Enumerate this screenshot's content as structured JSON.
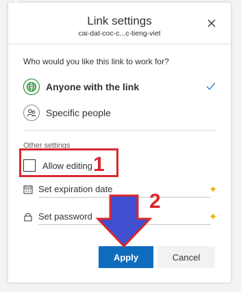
{
  "dialog": {
    "title": "Link settings",
    "subtitle": "cai-dat-coc-c...c-tieng-viet",
    "close_icon": "close-icon"
  },
  "audience": {
    "question": "Who would you like this link to work for?",
    "options": [
      {
        "label": "Anyone with the link",
        "icon": "globe-icon",
        "selected": true
      },
      {
        "label": "Specific people",
        "icon": "people-icon",
        "selected": false
      }
    ]
  },
  "other_settings": {
    "label": "Other settings",
    "allow_editing": {
      "label": "Allow editing",
      "checked": false
    },
    "expiration": {
      "label": "Set expiration date",
      "icon": "calendar-icon"
    },
    "password": {
      "label": "Set password",
      "icon": "lock-icon"
    }
  },
  "buttons": {
    "apply": "Apply",
    "cancel": "Cancel"
  },
  "annotations": {
    "step1": "1",
    "step2": "2"
  },
  "colors": {
    "accent": "#0f6cbd",
    "annotation_red": "#d9272e",
    "annotation_arrow": "#3f4fd0",
    "premium_gold": "#f2b200"
  }
}
